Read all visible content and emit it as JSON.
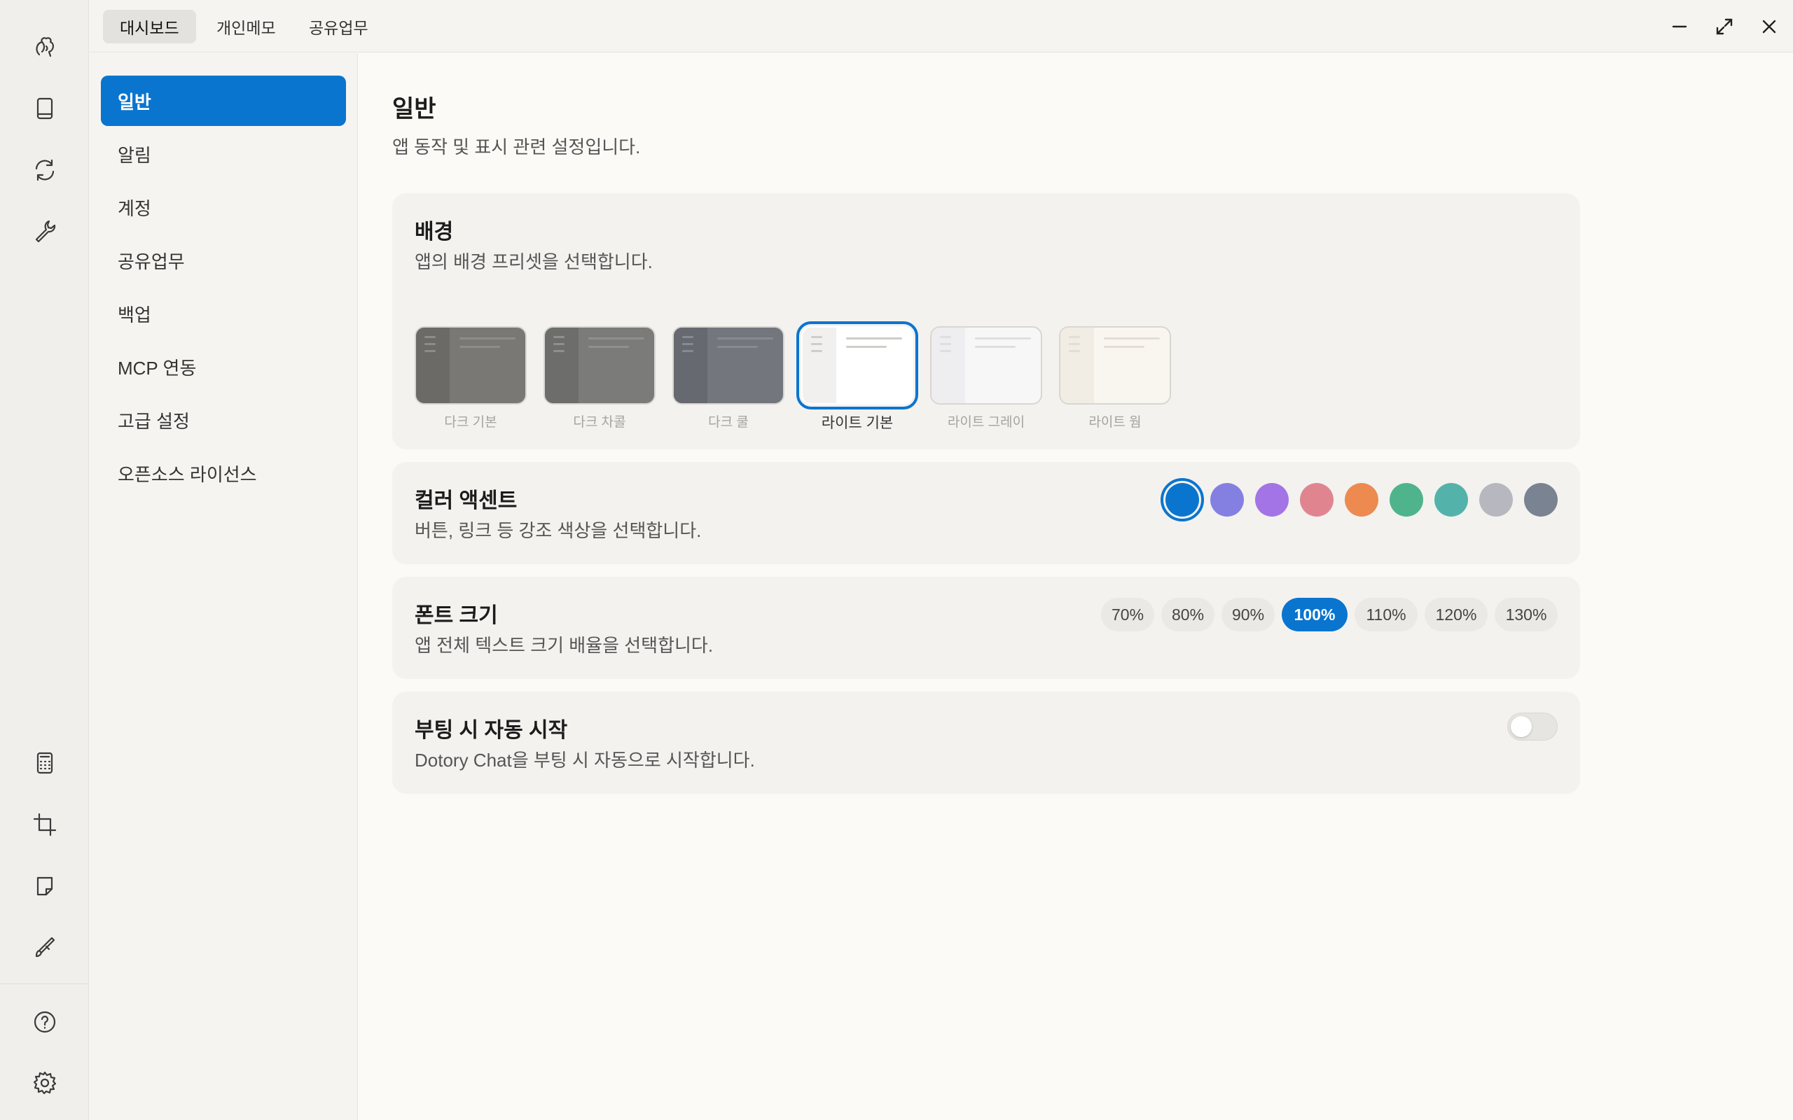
{
  "rail": {
    "top_icons": [
      "squirrel-logo-icon",
      "book-icon",
      "sync-icon",
      "wrench-icon"
    ],
    "bottom_icons": [
      "calculator-icon",
      "crop-icon",
      "note-icon",
      "brush-icon"
    ],
    "footer_icons": [
      "help-icon",
      "settings-gear-icon"
    ]
  },
  "topbar": {
    "tabs": [
      {
        "label": "대시보드",
        "active": true
      },
      {
        "label": "개인메모",
        "active": false
      },
      {
        "label": "공유업무",
        "active": false
      }
    ]
  },
  "settings_nav": {
    "items": [
      {
        "label": "일반",
        "active": true
      },
      {
        "label": "알림"
      },
      {
        "label": "계정"
      },
      {
        "label": "공유업무"
      },
      {
        "label": "백업"
      },
      {
        "label": "MCP 연동"
      },
      {
        "label": "고급 설정"
      },
      {
        "label": "오픈소스 라이선스"
      }
    ]
  },
  "main": {
    "title": "일반",
    "description": "앱 동작 및 표시 관련 설정입니다."
  },
  "background": {
    "title": "배경",
    "description": "앱의 배경 프리셋을 선택합니다.",
    "selected": "라이트 기본",
    "presets": [
      {
        "label": "다크 기본",
        "bg": "#7a7875",
        "side": "#6c6a67",
        "line": "#8e8c89"
      },
      {
        "label": "다크 차콜",
        "bg": "#7b7b79",
        "side": "#6d6d6b",
        "line": "#8f8f8d"
      },
      {
        "label": "다크 쿨",
        "bg": "#74767d",
        "side": "#676970",
        "line": "#888a91"
      },
      {
        "label": "라이트 기본",
        "bg": "#ffffff",
        "side": "#f1f0ee",
        "line": "#cfcdca"
      },
      {
        "label": "라이트 그레이",
        "bg": "#f7f7f8",
        "side": "#eeeef0",
        "line": "#dedee1"
      },
      {
        "label": "라이트 웜",
        "bg": "#f9f6ef",
        "side": "#f1ede4",
        "line": "#e3ded3"
      }
    ]
  },
  "accent": {
    "title": "컬러 액센트",
    "description": "버튼, 링크 등 강조 색상을 선택합니다.",
    "colors": [
      "#0a75cf",
      "#8480e2",
      "#a374e6",
      "#e08590",
      "#ec8a50",
      "#4fb48c",
      "#53b3aa",
      "#b7b8bf",
      "#7a8391"
    ],
    "selected_index": 0
  },
  "font_size": {
    "title": "폰트 크기",
    "description": "앱 전체 텍스트 크기 배율을 선택합니다.",
    "options": [
      "70%",
      "80%",
      "90%",
      "100%",
      "110%",
      "120%",
      "130%"
    ],
    "selected": "100%"
  },
  "autostart": {
    "title": "부팅 시 자동 시작",
    "description": "Dotory Chat을 부팅 시 자동으로 시작합니다.",
    "enabled": false
  }
}
